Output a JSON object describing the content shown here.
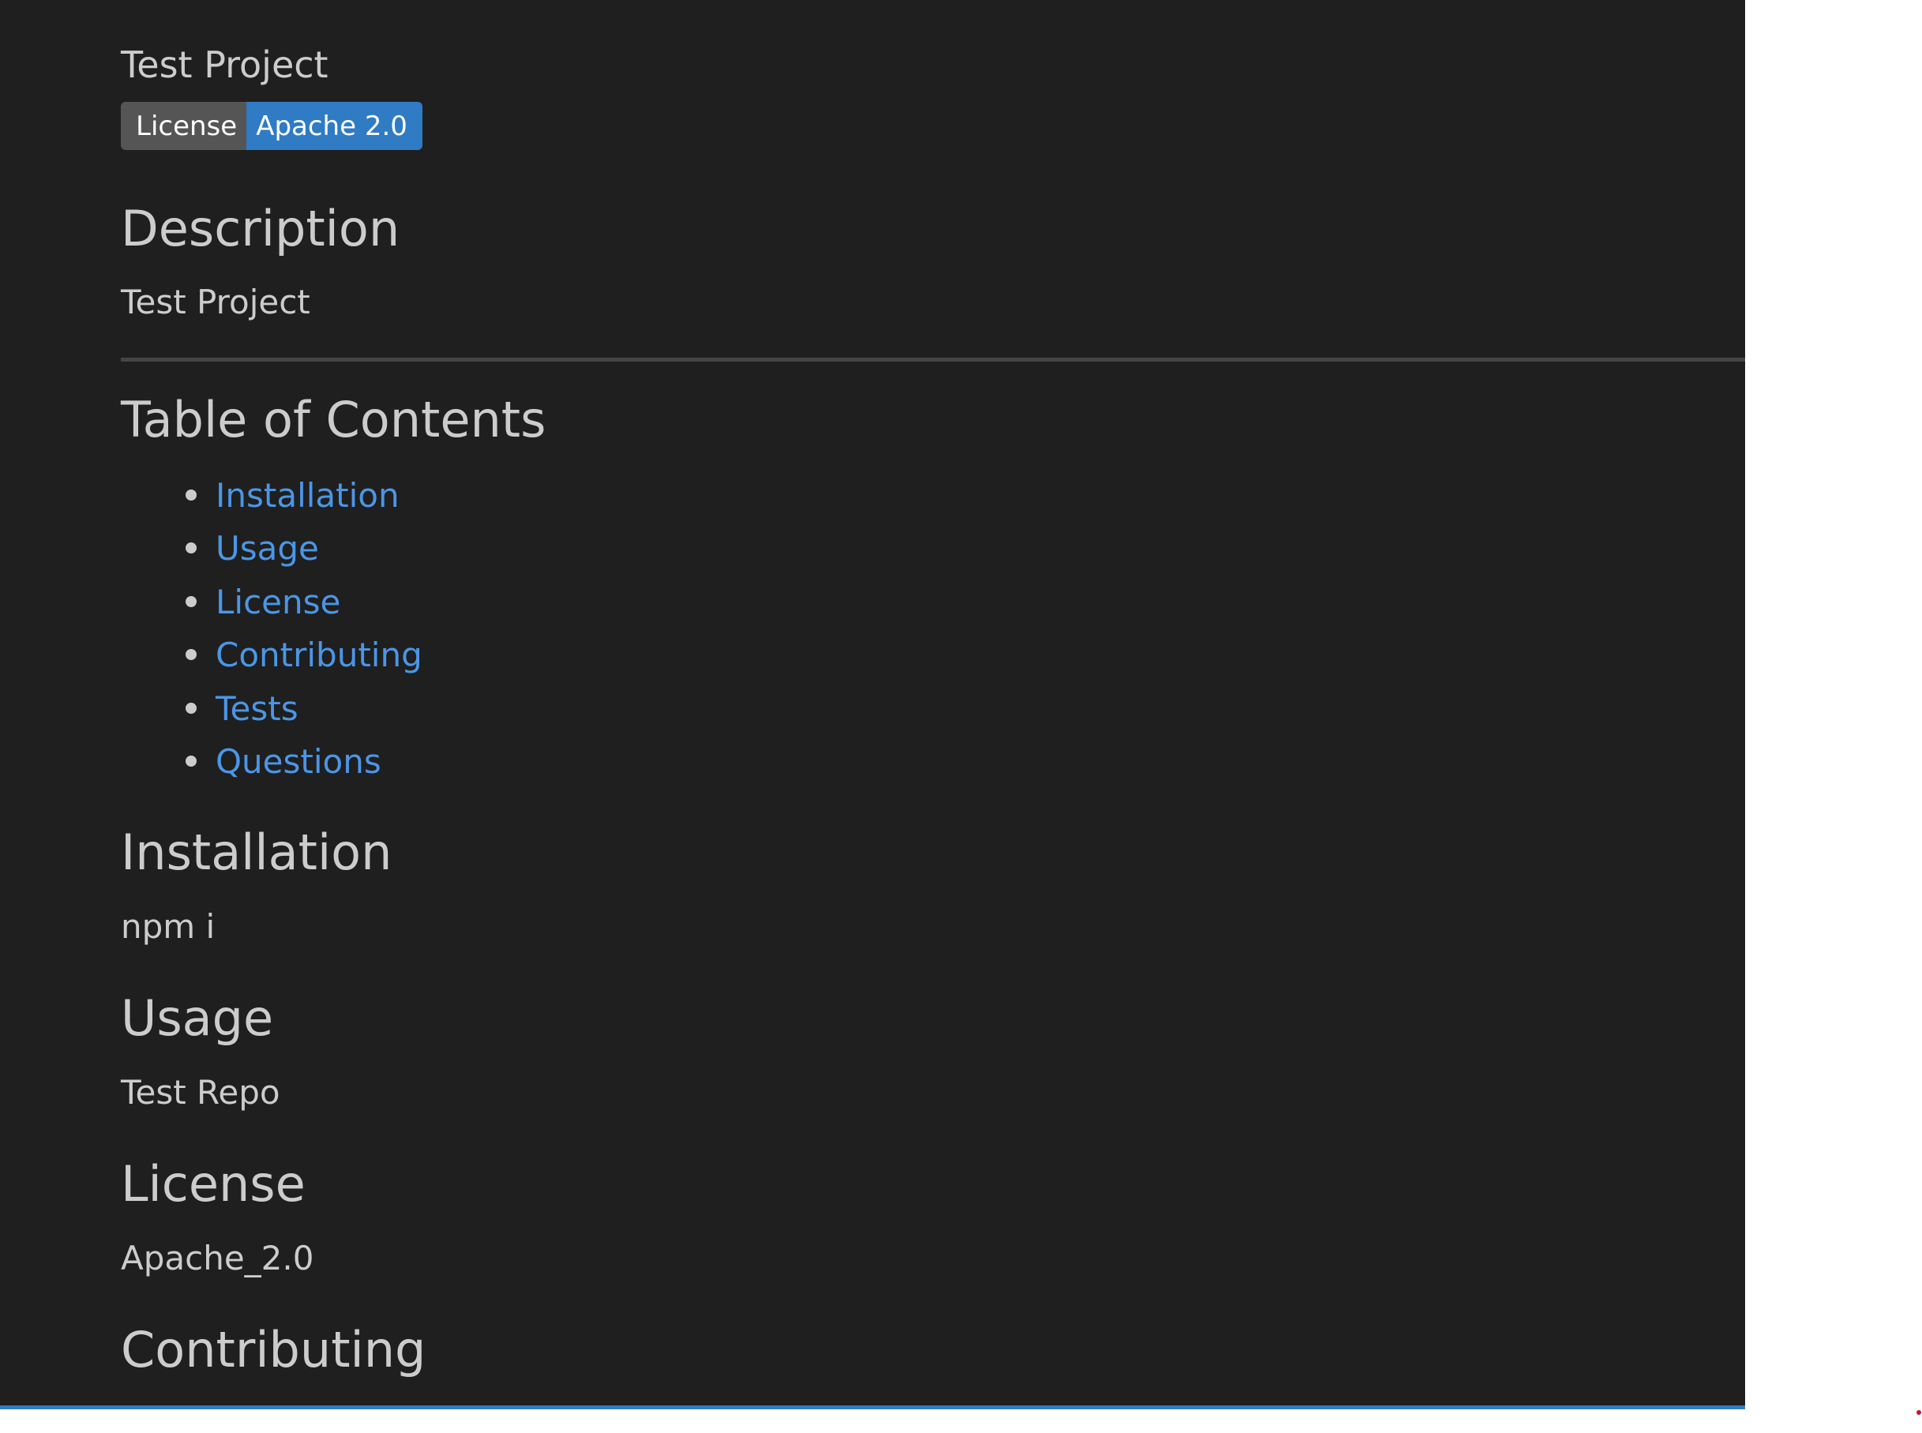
{
  "project_title": "Test Project",
  "badge": {
    "left_label": "License",
    "right_label": "Apache 2.0"
  },
  "sections": {
    "description": {
      "heading": "Description",
      "body": "Test Project"
    },
    "toc": {
      "heading": "Table of Contents",
      "items": [
        "Installation",
        "Usage",
        "License",
        "Contributing",
        "Tests",
        "Questions"
      ]
    },
    "installation": {
      "heading": "Installation",
      "body": "npm i"
    },
    "usage": {
      "heading": "Usage",
      "body": "Test Repo"
    },
    "license": {
      "heading": "License",
      "body": "Apache_2.0"
    },
    "contributing": {
      "heading": "Contributing"
    }
  },
  "colors": {
    "background": "#1f1f1f",
    "text": "#cccccc",
    "link": "#4b96e6",
    "badge_left": "#555555",
    "badge_right": "#2f7bc4",
    "accent_bar": "#2f7bc4"
  }
}
